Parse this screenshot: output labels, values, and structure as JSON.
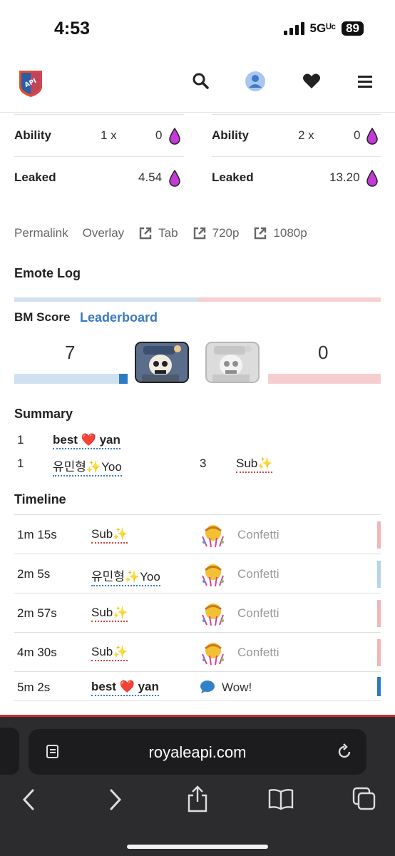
{
  "status": {
    "time": "4:53",
    "network": "5Gᵁᶜ",
    "battery": "89"
  },
  "nav": {
    "logo_text": "API"
  },
  "stats": {
    "left": [
      {
        "label": "Ability",
        "mult": "1 x",
        "value": "0"
      },
      {
        "label": "Leaked",
        "mult": "",
        "value": "4.54"
      }
    ],
    "right": [
      {
        "label": "Ability",
        "mult": "2 x",
        "value": "0"
      },
      {
        "label": "Leaked",
        "mult": "",
        "value": "13.20"
      }
    ]
  },
  "links": [
    "Permalink",
    "Overlay",
    "Tab",
    "720p",
    "1080p"
  ],
  "emote_log_title": "Emote Log",
  "bm": {
    "title": "BM Score",
    "link": "Leaderboard",
    "left_score": "7",
    "right_score": "0"
  },
  "summary": {
    "title": "Summary",
    "rows": [
      {
        "count": "1",
        "name": "best ❤️ yan"
      },
      {
        "count": "1",
        "name": "유민형✨Yoo",
        "count2": "3",
        "name2": "Sub✨"
      }
    ]
  },
  "timeline": {
    "title": "Timeline",
    "rows": [
      {
        "time": "1m 15s",
        "user": "Sub✨",
        "emote": "Confetti",
        "side": "red"
      },
      {
        "time": "2m 5s",
        "user": "유민형✨Yoo",
        "emote": "Confetti",
        "side": "blue"
      },
      {
        "time": "2m 57s",
        "user": "Sub✨",
        "emote": "Confetti",
        "side": "red"
      },
      {
        "time": "4m 30s",
        "user": "Sub✨",
        "emote": "Confetti",
        "side": "red"
      },
      {
        "time": "5m 2s",
        "user": "best ❤️ yan",
        "emote": "Wow!",
        "side": "blue-dark"
      }
    ]
  },
  "browser": {
    "url": "royaleapi.com"
  },
  "colors": {
    "blue": "#3b7bbf",
    "light_blue": "#cfe1f1",
    "light_red": "#f5cfd0",
    "drop": "#c23bd4"
  }
}
